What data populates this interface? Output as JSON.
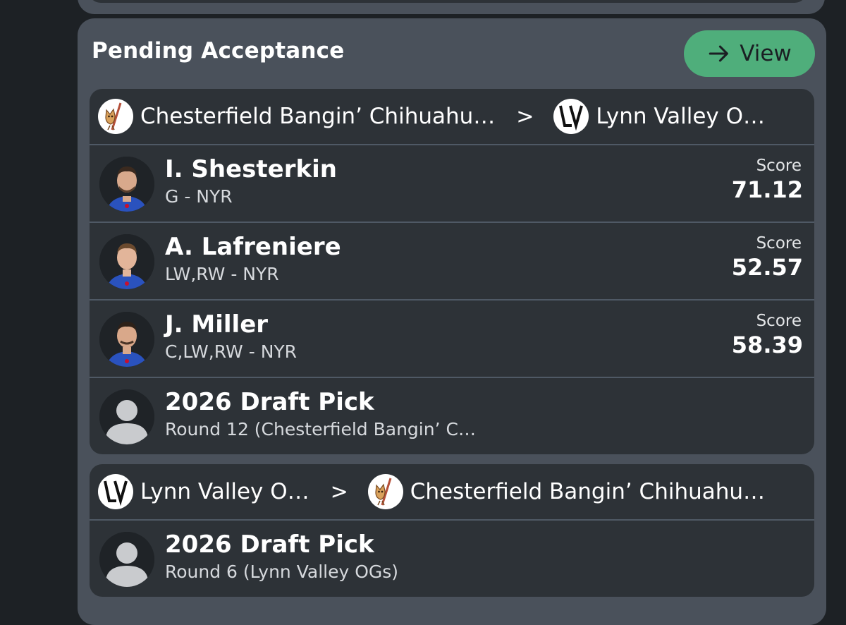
{
  "panel": {
    "title": "Pending Acceptance",
    "view_label": "View"
  },
  "trades": [
    {
      "from_team": "Chesterfield Bangin’ Chihuahu…",
      "to_team": "Lynn Valley O…",
      "separator": ">",
      "items": [
        {
          "name": "I. Shesterkin",
          "sub": "G - NYR",
          "score_label": "Score",
          "score": "71.12"
        },
        {
          "name": "A. Lafreniere",
          "sub": "LW,RW - NYR",
          "score_label": "Score",
          "score": "52.57"
        },
        {
          "name": "J. Miller",
          "sub": "C,LW,RW - NYR",
          "score_label": "Score",
          "score": "58.39"
        },
        {
          "name": "2026 Draft Pick",
          "sub": "Round 12 (Chesterfield Bangin’ C…"
        }
      ]
    },
    {
      "from_team": "Lynn Valley O…",
      "to_team": "Chesterfield Bangin’ Chihuahu…",
      "separator": ">",
      "items": [
        {
          "name": "2026 Draft Pick",
          "sub": "Round 6 (Lynn Valley OGs)"
        }
      ]
    }
  ],
  "colors": {
    "background": "#1d2125",
    "panel": "#4a515b",
    "card": "#2d3237",
    "accent_green": "#4fae7b",
    "jersey_blue": "#2a52be"
  },
  "icons": {
    "view_button": "arrow-right-icon",
    "chihuahua_logo": "chihuahua-logo-icon",
    "lv_logo": "lv-logo-icon",
    "placeholder": "person-placeholder-icon"
  }
}
